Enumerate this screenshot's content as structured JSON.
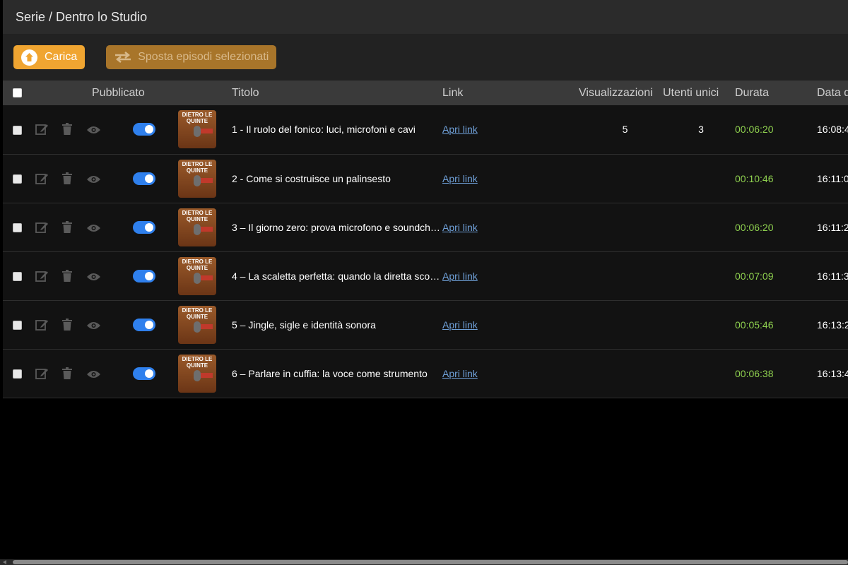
{
  "header": {
    "breadcrumb": "Serie / Dentro lo Studio"
  },
  "toolbar": {
    "upload_label": "Carica",
    "upload_icon": "arrow-up-circle-icon",
    "move_label": "Sposta episodi selezionati",
    "move_icon": "swap-arrows-icon"
  },
  "table": {
    "columns": [
      "Pubblicato",
      "Titolo",
      "Link",
      "Visualizzazioni",
      "Utenti unici",
      "Durata",
      "Data d"
    ],
    "thumbnail_text": [
      "DIETRO LE",
      "QUINTE"
    ],
    "rows": [
      {
        "title": "1 - Il ruolo del fonico: luci, microfoni e cavi",
        "link": "Apri link",
        "views": "5",
        "unique": "3",
        "duration": "00:06:20",
        "date": "16:08:4"
      },
      {
        "title": "2 - Come si costruisce un palinsesto",
        "link": "Apri link",
        "views": "",
        "unique": "",
        "duration": "00:10:46",
        "date": "16:11:0"
      },
      {
        "title": "3 – Il giorno zero: prova microfono e soundch…",
        "link": "Apri link",
        "views": "",
        "unique": "",
        "duration": "00:06:20",
        "date": "16:11:2"
      },
      {
        "title": "4 – La scaletta perfetta: quando la diretta scor…",
        "link": "Apri link",
        "views": "",
        "unique": "",
        "duration": "00:07:09",
        "date": "16:11:3"
      },
      {
        "title": "5 – Jingle, sigle e identità sonora",
        "link": "Apri link",
        "views": "",
        "unique": "",
        "duration": "00:05:46",
        "date": "16:13:2"
      },
      {
        "title": "6 – Parlare in cuffia: la voce come strumento",
        "link": "Apri link",
        "views": "",
        "unique": "",
        "duration": "00:06:38",
        "date": "16:13:4"
      }
    ]
  },
  "colors": {
    "accent": "#f0a531",
    "move_button": "#a8752a",
    "toggle": "#2f80ed",
    "duration": "#8fd14f",
    "link": "#6fa0d8"
  }
}
